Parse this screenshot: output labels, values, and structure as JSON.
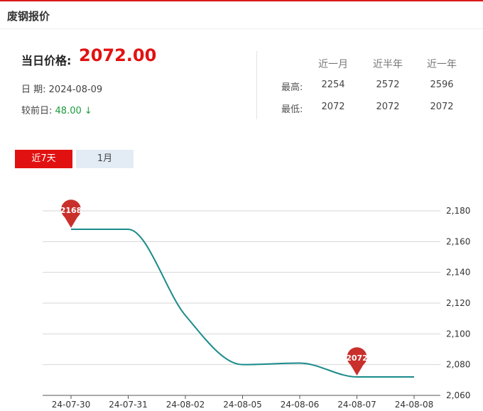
{
  "header": {
    "title": "废钢报价"
  },
  "summary": {
    "price_label": "当日价格:",
    "price_value": "2072.00",
    "date_label": "日 期:",
    "date_value": "2024-08-09",
    "change_label": "较前日:",
    "change_value": "48.00",
    "change_arrow": "↓"
  },
  "stats": {
    "headers": [
      "近一月",
      "近半年",
      "近一年"
    ],
    "rows": [
      {
        "label": "最高:",
        "values": [
          "2254",
          "2572",
          "2596"
        ]
      },
      {
        "label": "最低:",
        "values": [
          "2072",
          "2072",
          "2072"
        ]
      }
    ]
  },
  "tabs": [
    {
      "label": "近7天",
      "active": true
    },
    {
      "label": "1月",
      "active": false
    }
  ],
  "colors": {
    "accent": "#e21111",
    "line": "#1a8a8a",
    "marker": "#c9302c",
    "down": "#1c9c3a",
    "inactive_tab": "#e3ecf5"
  },
  "chart_data": {
    "type": "line",
    "categories": [
      "24-07-30",
      "24-07-31",
      "24-08-02",
      "24-08-05",
      "24-08-06",
      "24-08-07",
      "24-08-08"
    ],
    "values": [
      2168,
      2168,
      2112,
      2080,
      2081,
      2072,
      2072
    ],
    "ylim": [
      2060,
      2180
    ],
    "yticks": [
      "2,060",
      "2,080",
      "2,100",
      "2,120",
      "2,140",
      "2,160",
      "2,180"
    ],
    "y_axis_position": "right",
    "grid": true,
    "markers": [
      {
        "label": "2168",
        "index": 0
      },
      {
        "label": "2072",
        "index": 5
      }
    ]
  }
}
